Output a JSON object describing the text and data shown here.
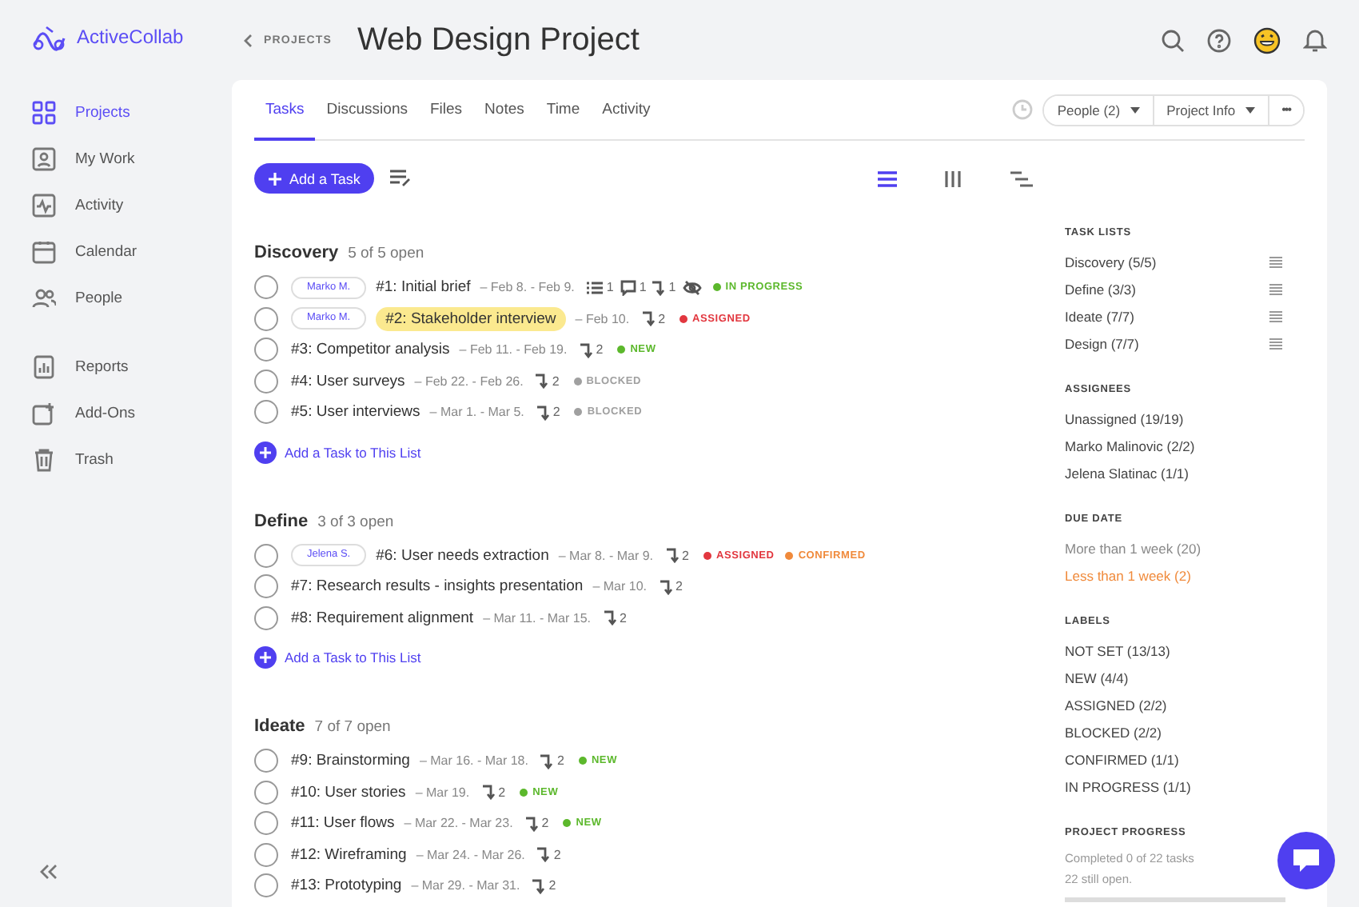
{
  "app": {
    "name": "ActiveCollab"
  },
  "sidebar": {
    "sections": [
      {
        "items": [
          {
            "label": "Projects",
            "selected": true
          },
          {
            "label": "My Work",
            "selected": false
          },
          {
            "label": "Activity",
            "selected": false
          },
          {
            "label": "Calendar",
            "selected": false
          },
          {
            "label": "People",
            "selected": false
          }
        ]
      },
      {
        "items": [
          {
            "label": "Reports",
            "selected": false
          },
          {
            "label": "Add-Ons",
            "selected": false
          },
          {
            "label": "Trash",
            "selected": false
          }
        ]
      }
    ]
  },
  "breadcrumb": "PROJECTS",
  "title": "Web Design Project",
  "tabs": [
    {
      "label": "Tasks",
      "selected": true
    },
    {
      "label": "Discussions",
      "selected": false
    },
    {
      "label": "Files",
      "selected": false
    },
    {
      "label": "Notes",
      "selected": false
    },
    {
      "label": "Time",
      "selected": false
    },
    {
      "label": "Activity",
      "selected": false
    }
  ],
  "header_buttons": [
    {
      "label": "People (2)",
      "kind": "dropdown"
    },
    {
      "label": "Project Info",
      "kind": "dropdown"
    },
    {
      "label": "•••",
      "kind": "more"
    }
  ],
  "add_task_button": "Add a Task",
  "view_modes": [
    {
      "kind": "list",
      "selected": true
    },
    {
      "kind": "columns",
      "selected": false
    },
    {
      "kind": "timeline",
      "selected": false
    }
  ],
  "task_lists": [
    {
      "name": "Discovery",
      "count": "5 of 5 open",
      "add_label": "Add a Task to This List",
      "tasks": [
        {
          "title": "#1: Initial brief",
          "checked": false,
          "assignee": "Marko M.",
          "highlighted": false,
          "dates": "– Feb 8. - Feb 9.",
          "meta": [
            {
              "kind": "checklist",
              "text": "1"
            },
            {
              "kind": "comment",
              "text": "1"
            },
            {
              "kind": "subtask",
              "text": "1"
            },
            {
              "kind": "hidden"
            }
          ],
          "labels": [
            {
              "text": "IN PROGRESS",
              "color": "#5cb82c"
            }
          ]
        },
        {
          "title": "#2: Stakeholder interview",
          "checked": false,
          "assignee": "Marko M.",
          "highlighted": true,
          "dates": "– Feb 10.",
          "meta": [
            {
              "kind": "subtask",
              "text": "2"
            }
          ],
          "labels": [
            {
              "text": "ASSIGNED",
              "color": "#e2373f"
            }
          ]
        },
        {
          "title": "#3: Competitor analysis",
          "checked": false,
          "highlighted": false,
          "dates": "– Feb 11. - Feb 19.",
          "meta": [
            {
              "kind": "subtask",
              "text": "2"
            }
          ],
          "labels": [
            {
              "text": "NEW",
              "color": "#5cb82c"
            }
          ]
        },
        {
          "title": "#4: User surveys",
          "checked": false,
          "highlighted": false,
          "dates": "– Feb 22. - Feb 26.",
          "meta": [
            {
              "kind": "subtask",
              "text": "2"
            }
          ],
          "labels": [
            {
              "text": "BLOCKED",
              "color": "#a0a0a0"
            }
          ]
        },
        {
          "title": "#5: User interviews",
          "checked": false,
          "highlighted": false,
          "dates": "– Mar 1. - Mar 5.",
          "meta": [
            {
              "kind": "subtask",
              "text": "2"
            }
          ],
          "labels": [
            {
              "text": "BLOCKED",
              "color": "#a0a0a0"
            }
          ]
        }
      ]
    },
    {
      "name": "Define",
      "count": "3 of 3 open",
      "add_label": "Add a Task to This List",
      "tasks": [
        {
          "title": "#6: User needs extraction",
          "checked": false,
          "assignee": "Jelena S.",
          "highlighted": false,
          "dates": "– Mar 8. - Mar 9.",
          "meta": [
            {
              "kind": "subtask",
              "text": "2"
            }
          ],
          "labels": [
            {
              "text": "ASSIGNED",
              "color": "#e2373f"
            },
            {
              "text": "CONFIRMED",
              "color": "#f08a3b"
            }
          ]
        },
        {
          "title": "#7: Research results - insights presentation",
          "checked": false,
          "highlighted": false,
          "dates": "– Mar 10.",
          "meta": [
            {
              "kind": "subtask",
              "text": "2"
            }
          ]
        },
        {
          "title": "#8: Requirement alignment",
          "checked": false,
          "highlighted": false,
          "dates": "– Mar 11. - Mar 15.",
          "meta": [
            {
              "kind": "subtask",
              "text": "2"
            }
          ]
        }
      ]
    },
    {
      "name": "Ideate",
      "count": "7 of 7 open",
      "tasks": [
        {
          "title": "#9: Brainstorming",
          "checked": false,
          "highlighted": false,
          "dates": "– Mar 16. - Mar 18.",
          "meta": [
            {
              "kind": "subtask",
              "text": "2"
            }
          ],
          "labels": [
            {
              "text": "NEW",
              "color": "#5cb82c"
            }
          ]
        },
        {
          "title": "#10: User stories",
          "checked": false,
          "highlighted": false,
          "dates": "– Mar 19.",
          "meta": [
            {
              "kind": "subtask",
              "text": "2"
            }
          ],
          "labels": [
            {
              "text": "NEW",
              "color": "#5cb82c"
            }
          ]
        },
        {
          "title": "#11: User flows",
          "checked": false,
          "highlighted": false,
          "dates": "– Mar 22. - Mar 23.",
          "meta": [
            {
              "kind": "subtask",
              "text": "2"
            }
          ],
          "labels": [
            {
              "text": "NEW",
              "color": "#5cb82c"
            }
          ]
        },
        {
          "title": "#12: Wireframing",
          "checked": false,
          "highlighted": false,
          "dates": "– Mar 24. - Mar 26.",
          "meta": [
            {
              "kind": "subtask",
              "text": "2"
            }
          ]
        },
        {
          "title": "#13: Prototyping",
          "checked": false,
          "highlighted": false,
          "dates": "– Mar 29. - Mar 31.",
          "meta": [
            {
              "kind": "subtask",
              "text": "2"
            }
          ]
        }
      ]
    }
  ],
  "filters": [
    {
      "heading": "TASK LISTS",
      "kind": "reorder",
      "items": [
        {
          "label": "Discovery (5/5)"
        },
        {
          "label": "Define (3/3)"
        },
        {
          "label": "Ideate (7/7)"
        },
        {
          "label": "Design (7/7)"
        }
      ]
    },
    {
      "heading": "ASSIGNEES",
      "kind": "plain",
      "items": [
        {
          "label": "Unassigned (19/19)"
        },
        {
          "label": "Marko Malinovic (2/2)"
        },
        {
          "label": "Jelena Slatinac (1/1)"
        }
      ]
    },
    {
      "heading": "DUE DATE",
      "kind": "plain",
      "items": [
        {
          "label": "More than 1 week (20)",
          "color": "#888888"
        },
        {
          "label": "Less than 1 week (2)",
          "color": "#f08a3b"
        }
      ]
    },
    {
      "heading": "LABELS",
      "kind": "plain",
      "items": [
        {
          "label": "NOT SET (13/13)"
        },
        {
          "label": "NEW (4/4)"
        },
        {
          "label": "ASSIGNED (2/2)"
        },
        {
          "label": "BLOCKED (2/2)"
        },
        {
          "label": "CONFIRMED (1/1)"
        },
        {
          "label": "IN PROGRESS (1/1)"
        }
      ]
    }
  ],
  "project_progress": {
    "heading": "PROJECT PROGRESS",
    "lines": [
      "Completed 0 of 22 tasks",
      "22 still open."
    ],
    "level": 0
  }
}
